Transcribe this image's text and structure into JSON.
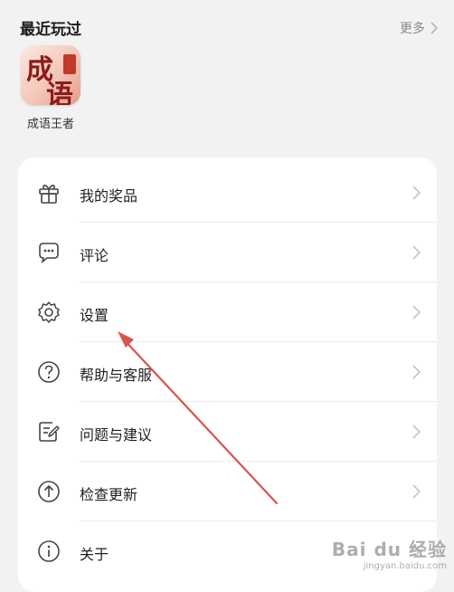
{
  "recent": {
    "title": "最近玩过",
    "more_label": "更多",
    "games": [
      {
        "name": "成语王者",
        "icon_text": "成语"
      }
    ]
  },
  "menu": {
    "items": [
      {
        "label": "我的奖品",
        "icon": "gift-icon"
      },
      {
        "label": "评论",
        "icon": "comment-icon"
      },
      {
        "label": "设置",
        "icon": "gear-icon"
      },
      {
        "label": "帮助与客服",
        "icon": "help-icon"
      },
      {
        "label": "问题与建议",
        "icon": "feedback-icon"
      },
      {
        "label": "检查更新",
        "icon": "update-icon"
      },
      {
        "label": "关于",
        "icon": "info-icon"
      }
    ]
  },
  "watermark": {
    "brand": "Bai du 经验",
    "sub": "jingyan.baidu.com"
  },
  "colors": {
    "background": "#f2f2f2",
    "card": "#ffffff",
    "annotation_arrow": "#d9534f"
  }
}
